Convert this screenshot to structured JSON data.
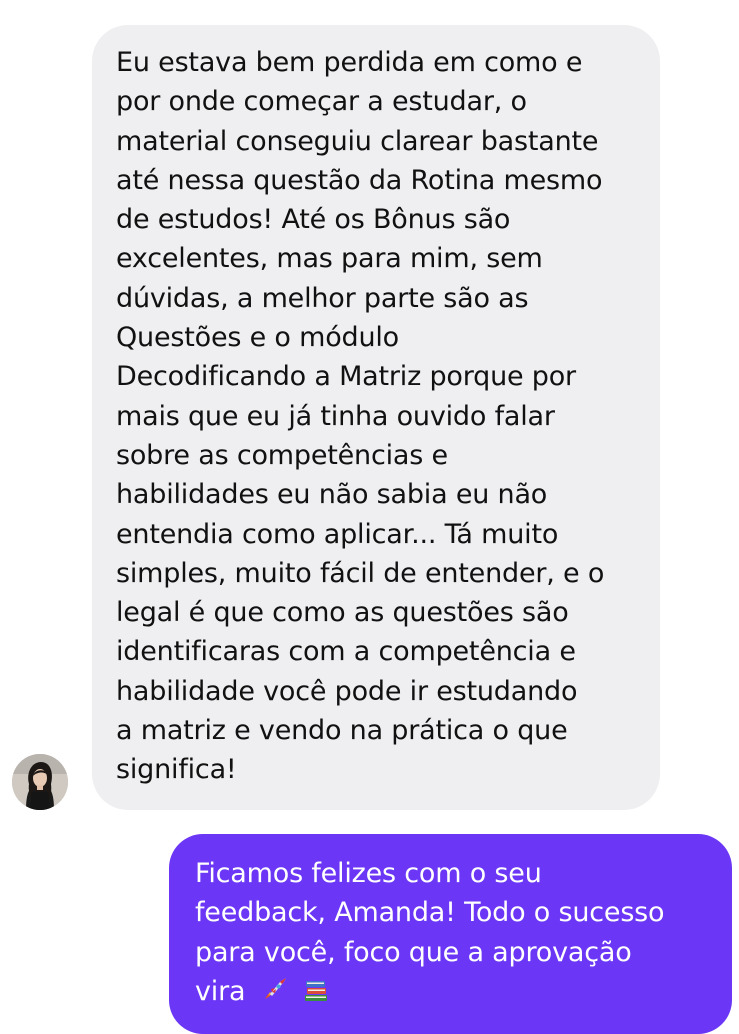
{
  "conversation": {
    "incoming": {
      "lines": [
        "Eu estava bem perdida em como e",
        "por onde começar a estudar, o",
        "material conseguiu clarear bastante",
        "até nessa questão da Rotina mesmo",
        "de estudos! Até os Bônus são",
        "excelentes, mas para mim, sem",
        "dúvidas, a melhor parte são as",
        "Questões e o módulo",
        "Decodificando a Matriz porque por",
        "mais que eu já tinha ouvido falar",
        "sobre as competências e",
        "habilidades eu não sabia eu não",
        "entendia como aplicar... Tá muito",
        "simples, muito fácil de entender, e o",
        "legal é que como as questões são",
        "identificaras com a competência e",
        "habilidade você pode ir estudando",
        "a matriz e vendo na prática o que",
        "significa!"
      ],
      "bubble_color": "#efeff2",
      "text_color": "#111111"
    },
    "outgoing": {
      "lines": [
        "Ficamos felizes com o seu",
        "feedback, Amanda! Todo o sucesso",
        "para você, foco que a aprovação",
        "vira"
      ],
      "emojis": [
        "rocket-icon",
        "books-icon"
      ],
      "bubble_color": "#6b36f5",
      "text_color": "#ffffff"
    }
  }
}
